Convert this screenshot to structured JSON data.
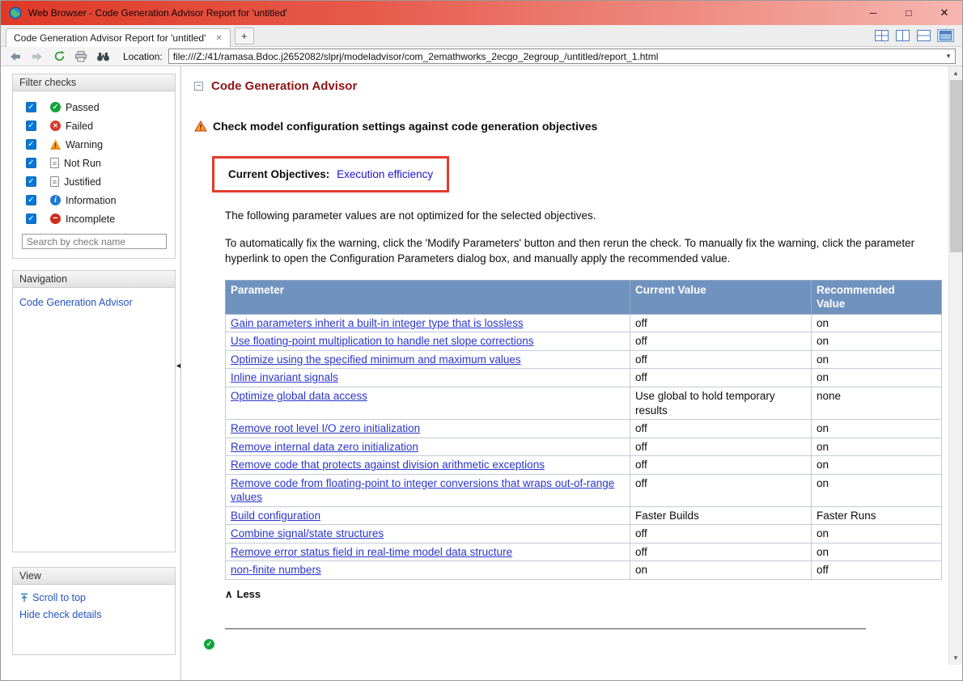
{
  "window": {
    "title": "Web Browser - Code Generation Advisor Report for 'untitled'"
  },
  "icons": {
    "minimize": "─",
    "maximize": "□",
    "close": "✕",
    "tab_close": "✕",
    "new_tab": "+",
    "url_dropdown": "▾",
    "scroll_up": "▲",
    "scroll_down": "▼",
    "sidebar_collapse": "◄",
    "less_caret": "∧",
    "section_collapse": "−"
  },
  "tab_bar": {
    "active_tab": "Code Generation Advisor Report for 'untitled'"
  },
  "toolbar": {
    "location_label": "Location:",
    "url": "file:///Z:/41/ramasa.Bdoc.j2652082/slprj/modeladvisor/com_2emathworks_2ecgo_2egroup_/untitled/report_1.html"
  },
  "sidebar": {
    "filter": {
      "title": "Filter checks",
      "search_placeholder": "Search by check name",
      "items": [
        {
          "label": "Passed",
          "icon": "passed-icon",
          "checked": true
        },
        {
          "label": "Failed",
          "icon": "failed-icon",
          "checked": true
        },
        {
          "label": "Warning",
          "icon": "warning-icon",
          "checked": true
        },
        {
          "label": "Not Run",
          "icon": "not-run-icon",
          "checked": true
        },
        {
          "label": "Justified",
          "icon": "justified-icon",
          "checked": true
        },
        {
          "label": "Information",
          "icon": "information-icon",
          "checked": true
        },
        {
          "label": "Incomplete",
          "icon": "incomplete-icon",
          "checked": true
        }
      ]
    },
    "navigation": {
      "title": "Navigation",
      "links": [
        {
          "label": "Code Generation Advisor"
        }
      ]
    },
    "view": {
      "title": "View",
      "links": [
        {
          "label": "Scroll to top",
          "icon": "scroll-to-top-icon"
        },
        {
          "label": "Hide check details"
        }
      ]
    }
  },
  "report": {
    "section_title": "Code Generation Advisor",
    "check_title": "Check model configuration settings against code generation objectives",
    "objectives_label": "Current Objectives:",
    "objectives_value": "Execution efficiency",
    "intro_text": "The following parameter values are not optimized for the selected objectives.",
    "fix_instructions": "To automatically fix the warning, click the 'Modify Parameters' button and then rerun the check. To manually fix the warning, click the parameter hyperlink to open the Configuration Parameters dialog box, and manually apply the recommended value.",
    "table": {
      "headers": [
        "Parameter",
        "Current Value",
        "Recommended Value"
      ],
      "rows": [
        {
          "parameter": "Gain parameters inherit a built-in integer type that is lossless",
          "current": "off",
          "recommended": "on"
        },
        {
          "parameter": "Use floating-point multiplication to handle net slope corrections",
          "current": "off",
          "recommended": "on"
        },
        {
          "parameter": "Optimize using the specified minimum and maximum values",
          "current": "off",
          "recommended": "on"
        },
        {
          "parameter": "Inline invariant signals",
          "current": "off",
          "recommended": "on"
        },
        {
          "parameter": "Optimize global data access",
          "current": "Use global to hold temporary results",
          "recommended": "none"
        },
        {
          "parameter": "Remove root level I/O zero initialization",
          "current": "off",
          "recommended": "on"
        },
        {
          "parameter": "Remove internal data zero initialization",
          "current": "off",
          "recommended": "on"
        },
        {
          "parameter": "Remove code that protects against division arithmetic exceptions",
          "current": "off",
          "recommended": "on"
        },
        {
          "parameter": "Remove code from floating-point to integer conversions that wraps out-of-range values",
          "current": "off",
          "recommended": "on"
        },
        {
          "parameter": "Build configuration",
          "current": "Faster Builds",
          "recommended": "Faster Runs"
        },
        {
          "parameter": "Combine signal/state structures",
          "current": "off",
          "recommended": "on"
        },
        {
          "parameter": "Remove error status field in real-time model data structure",
          "current": "off",
          "recommended": "on"
        },
        {
          "parameter": "non-finite numbers",
          "current": "on",
          "recommended": "off"
        }
      ]
    },
    "less_label": "Less"
  },
  "colors": {
    "titlebar_red": "#df3a28",
    "table_header_blue": "#7092be",
    "link_blue": "#2a35cc",
    "section_title_red": "#8e1414",
    "objectives_border_red": "#e23b2b"
  }
}
